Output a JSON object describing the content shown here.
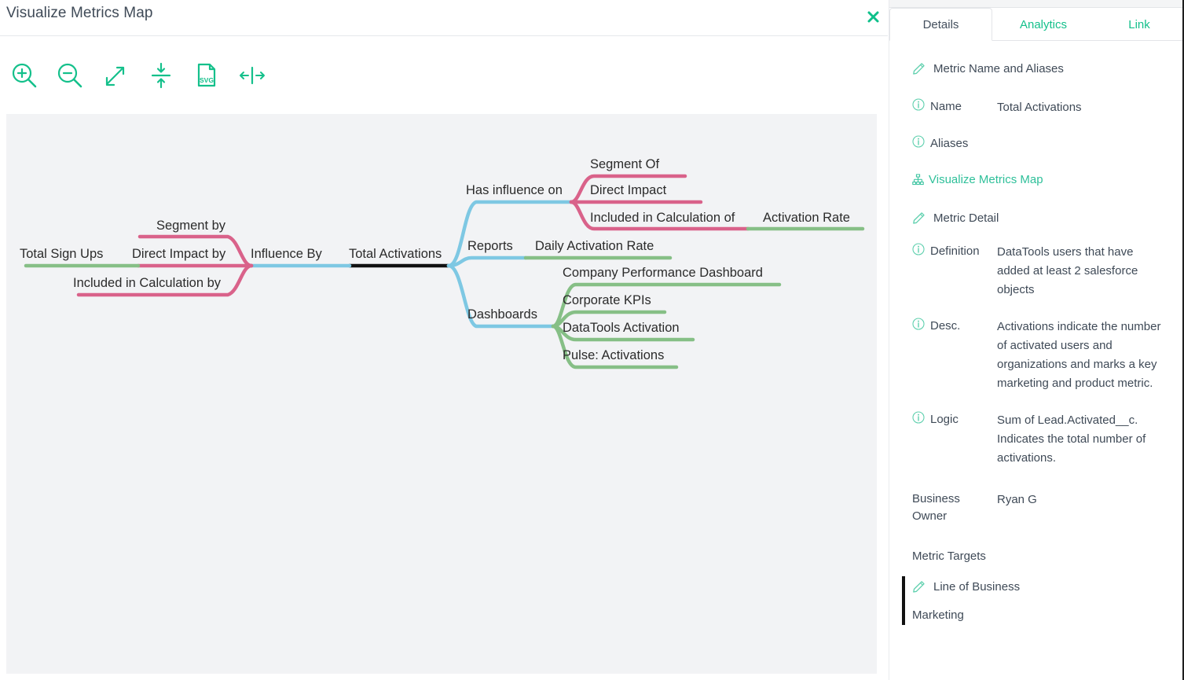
{
  "modal": {
    "title": "Visualize Metrics Map",
    "close_label": "×"
  },
  "toolbar": {
    "items": [
      {
        "name": "zoom-in-icon",
        "tooltip": "Zoom In"
      },
      {
        "name": "zoom-out-icon",
        "tooltip": "Zoom Out"
      },
      {
        "name": "expand-icon",
        "tooltip": "Expand"
      },
      {
        "name": "fit-vertical-icon",
        "tooltip": "Fit Vertically"
      },
      {
        "name": "export-svg-icon",
        "tooltip": "Export SVG",
        "label": "SVG"
      },
      {
        "name": "fit-horizontal-icon",
        "tooltip": "Fit Horizontally"
      }
    ]
  },
  "map": {
    "root": "Total Activations",
    "nodes": {
      "influence_by": "Influence By",
      "direct_impact_by": "Direct Impact by",
      "segment_by": "Segment by",
      "included_in_calculation_by": "Included in Calculation by",
      "total_sign_ups": "Total Sign Ups",
      "has_influence_on": "Has influence on",
      "segment_of": "Segment Of",
      "direct_impact": "Direct Impact",
      "included_in_calculation_of": "Included in Calculation of",
      "activation_rate": "Activation Rate",
      "reports": "Reports",
      "daily_activation_rate": "Daily Activation Rate",
      "dashboards": "Dashboards",
      "company_performance_dashboard": "Company Performance Dashboard",
      "corporate_kpis": "Corporate KPIs",
      "datatools_activation": "DataTools Activation",
      "pulse_activations": "Pulse: Activations"
    },
    "colors": {
      "root": "#111111",
      "relationship": "#7ec8e3",
      "link": "#d9628a",
      "metric": "#86bf86",
      "canvas_bg": "#f2f3f5"
    }
  },
  "panel": {
    "tabs": [
      {
        "label": "Details",
        "active": true
      },
      {
        "label": "Analytics",
        "active": false
      },
      {
        "label": "Link",
        "active": false
      }
    ],
    "section_name_aliases": "Metric Name and Aliases",
    "name_label": "Name",
    "name_value": "Total Activations",
    "aliases_label": "Aliases",
    "aliases_value": "",
    "visualize_link": "Visualize Metrics Map",
    "section_metric_detail": "Metric Detail",
    "definition_label": "Definition",
    "definition_value": "DataTools users that have added at least 2 salesforce objects",
    "desc_label": "Desc.",
    "desc_value": "Activations indicate the number of activated users and organizations and marks a key marketing and product metric.",
    "logic_label": "Logic",
    "logic_value": "Sum of Lead.Activated__c. Indicates the total number of activations.",
    "business_owner_label": "Business Owner",
    "business_owner_value": "Ryan G",
    "metric_targets_label": "Metric Targets",
    "metric_targets_value": "",
    "line_of_business_label": "Line of Business",
    "line_of_business_value": "Marketing",
    "accent_green": "#14c08b",
    "text_dark": "#3f4a57"
  }
}
